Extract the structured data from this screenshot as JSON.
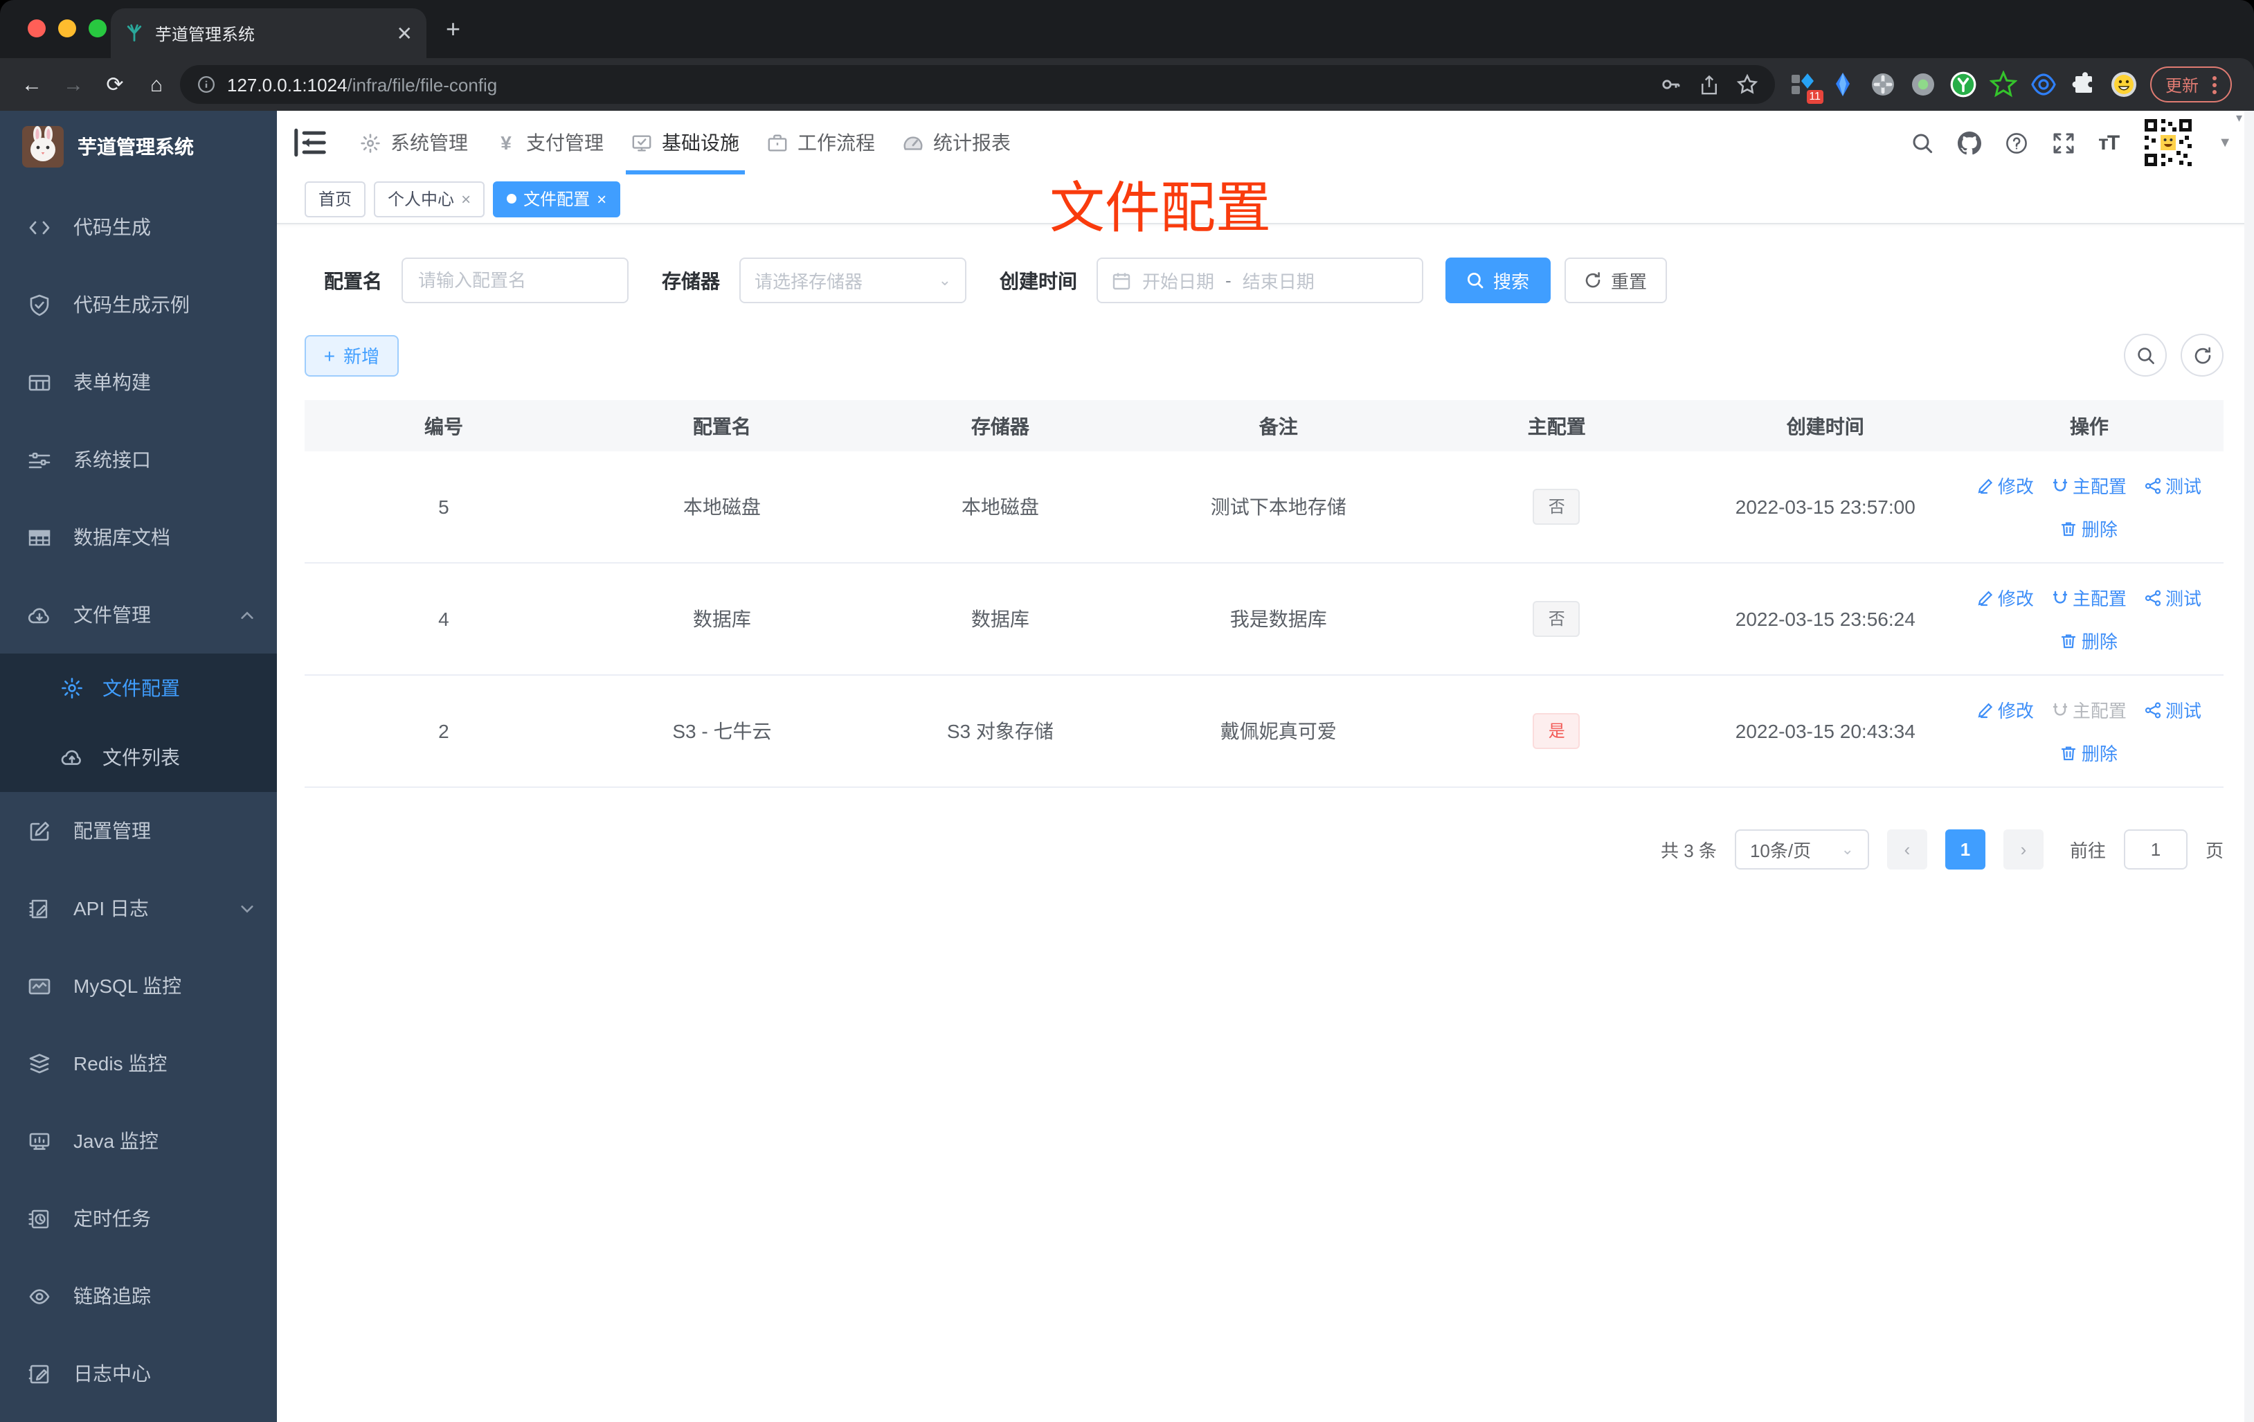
{
  "browser": {
    "tab_title": "芋道管理系统",
    "url_host": "127.0.0.1:1024",
    "url_path": "/infra/file/file-config",
    "update_label": "更新",
    "extension_badge": "11"
  },
  "sidebar": {
    "app_title": "芋道管理系统",
    "items": {
      "codegen": "代码生成",
      "codegen_demo": "代码生成示例",
      "form_builder": "表单构建",
      "system_api": "系统接口",
      "db_doc": "数据库文档",
      "file_mgmt": "文件管理",
      "file_config": "文件配置",
      "file_list": "文件列表",
      "config_mgmt": "配置管理",
      "api_log": "API 日志",
      "mysql": "MySQL 监控",
      "redis": "Redis 监控",
      "java": "Java 监控",
      "cron": "定时任务",
      "trace": "链路追踪",
      "log_center": "日志中心"
    }
  },
  "topnav": {
    "system": "系统管理",
    "payment": "支付管理",
    "infra": "基础设施",
    "workflow": "工作流程",
    "report": "统计报表"
  },
  "tags": {
    "home": "首页",
    "profile": "个人中心",
    "file_config": "文件配置"
  },
  "annotation": "文件配置",
  "filter": {
    "name_label": "配置名",
    "name_placeholder": "请输入配置名",
    "storage_label": "存储器",
    "storage_placeholder": "请选择存储器",
    "time_label": "创建时间",
    "start_placeholder": "开始日期",
    "separator": "-",
    "end_placeholder": "结束日期",
    "search_label": "搜索",
    "reset_label": "重置"
  },
  "toolbar": {
    "add_label": "新增"
  },
  "table": {
    "headers": [
      "编号",
      "配置名",
      "存储器",
      "备注",
      "主配置",
      "创建时间",
      "操作"
    ],
    "rows": [
      {
        "id": "5",
        "name": "本地磁盘",
        "storage": "本地磁盘",
        "remark": "测试下本地存储",
        "master": "否",
        "created": "2022-03-15 23:57:00"
      },
      {
        "id": "4",
        "name": "数据库",
        "storage": "数据库",
        "remark": "我是数据库",
        "master": "否",
        "created": "2022-03-15 23:56:24"
      },
      {
        "id": "2",
        "name": "S3 - 七牛云",
        "storage": "S3 对象存储",
        "remark": "戴佩妮真可爱",
        "master": "是",
        "created": "2022-03-15 20:43:34"
      }
    ],
    "actions": {
      "edit": "修改",
      "master": "主配置",
      "test": "测试",
      "del": "删除"
    }
  },
  "pagination": {
    "total": "共 3 条",
    "page_size": "10条/页",
    "page": "1",
    "goto_label": "前往",
    "goto_value": "1",
    "unit": "页"
  },
  "colors": {
    "accent": "#409eff",
    "annotation_red": "#f93b0d",
    "master_yes_red": "#f56c6c",
    "sidebar_bg": "#304156",
    "submenu_bg": "#1f2d3d"
  }
}
